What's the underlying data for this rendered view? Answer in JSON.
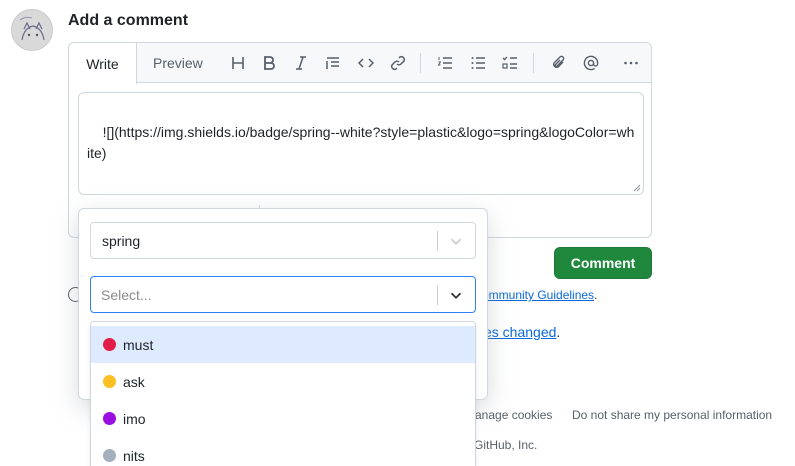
{
  "comment": {
    "heading": "Add a comment",
    "tabs": {
      "write": "Write",
      "preview": "Preview"
    },
    "toolbar_icons": [
      "heading-icon",
      "bold-icon",
      "italic-icon",
      "quote-icon",
      "code-icon",
      "link-icon",
      "numbered-list-icon",
      "bullet-list-icon",
      "task-list-icon",
      "attach-icon",
      "mention-icon",
      "more-icon"
    ],
    "body_text": "![](https://img.shields.io/badge/spring--white?style=plastic&logo=spring&logoColor=white)",
    "submit_label": "Comment"
  },
  "background": {
    "guidelines_link": "ommunity Guidelines",
    "guidelines_suffix": ".",
    "files_link": "es changed",
    "files_suffix": ".",
    "footer_cookies": "anage cookies",
    "footer_privacy": "Do not share my personal information",
    "copyright": "GitHub, Inc."
  },
  "popover": {
    "first_select_value": "spring",
    "second_select_placeholder": "Select...",
    "options": [
      {
        "label": "must",
        "color": "#e11d48"
      },
      {
        "label": "ask",
        "color": "#fbbf24"
      },
      {
        "label": "imo",
        "color": "#9b0ee0"
      },
      {
        "label": "nits",
        "color": "#a4b0be"
      }
    ]
  },
  "colors": {
    "accent": "#1f883d",
    "focus": "#2f81f7",
    "link": "#0969da"
  }
}
